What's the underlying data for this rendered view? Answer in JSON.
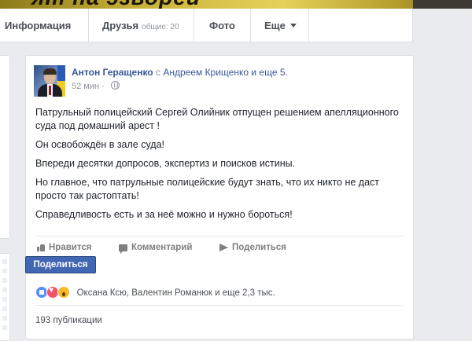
{
  "cover": {
    "text": "ят на эзвореи"
  },
  "tabs": {
    "info": "Информация",
    "friends": "Друзья",
    "friends_sub": "общие: 20",
    "photo": "Фото",
    "more": "Еще"
  },
  "post": {
    "author": "Антон Геращенко",
    "with_word": "с",
    "tagged": "Андреем Крищенко и еще 5.",
    "time": "52 мин",
    "paragraphs": [
      "Патрульный полицейский Сергей Олийник отпущен решением апелляционного суда под домашний арест !",
      "Он освобождён в зале суда!",
      "Впереди десятки допросов, экспертиз и поисков истины.",
      "Но главное, что патрульные полицейские будут знать, что их никто не даст просто так растоптать!",
      "Справедливость есть и за неё можно и нужно бороться!"
    ],
    "actions": {
      "like": "Нравится",
      "comment": "Комментарий",
      "share": "Поделиться"
    },
    "share_popup": "Поделиться",
    "reactions_text": "Оксана Ксю, Валентин Романюк и еще 2,3 тыс.",
    "shares_text": "193 публикации"
  },
  "colors": {
    "link": "#365899",
    "share_button": "#4267b2",
    "background": "#e9ebee"
  }
}
